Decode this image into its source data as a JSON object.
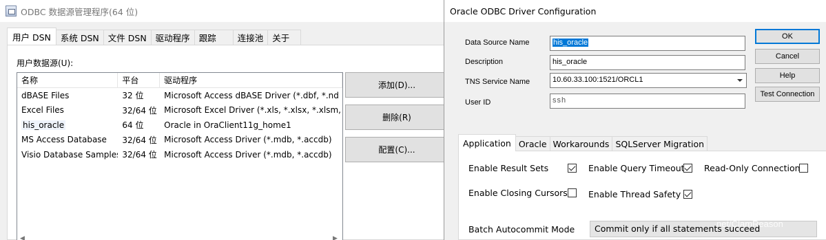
{
  "odbc": {
    "title": "ODBC 数据源管理程序(64 位)",
    "tabs": [
      "用户 DSN",
      "系统 DSN",
      "文件 DSN",
      "驱动程序",
      "跟踪",
      "连接池",
      "关于"
    ],
    "active_tab": "用户 DSN",
    "panel_label": "用户数据源(U):",
    "columns": [
      "名称",
      "平台",
      "驱动程序"
    ],
    "rows": [
      {
        "name": "dBASE Files",
        "platform": "32 位",
        "driver": "Microsoft Access dBASE Driver (*.dbf, *.nd"
      },
      {
        "name": "Excel Files",
        "platform": "32/64 位",
        "driver": "Microsoft Excel Driver (*.xls, *.xlsx, *.xlsm, *"
      },
      {
        "name": "his_oracle",
        "platform": "64 位",
        "driver": "Oracle in OraClient11g_home1"
      },
      {
        "name": "MS Access Database",
        "platform": "32/64 位",
        "driver": "Microsoft Access Driver (*.mdb, *.accdb)"
      },
      {
        "name": "Visio Database Samples",
        "platform": "32/64 位",
        "driver": "Microsoft Access Driver (*.mdb, *.accdb)"
      }
    ],
    "buttons": {
      "add": "添加(D)...",
      "remove": "删除(R)",
      "configure": "配置(C)..."
    }
  },
  "oracle": {
    "title": "Oracle ODBC Driver Configuration",
    "fields": {
      "data_source_name_label": "Data Source Name",
      "data_source_name": "his_oracle",
      "description_label": "Description",
      "description": "his_oracle",
      "tns_label": "TNS Service Name",
      "tns": "10.60.33.100:1521/ORCL1",
      "userid_label": "User ID",
      "userid": "ssh"
    },
    "buttons": {
      "ok": "OK",
      "cancel": "Cancel",
      "help": "Help",
      "test": "Test Connection"
    },
    "tabs": [
      "Application",
      "Oracle",
      "Workarounds",
      "SQLServer Migration"
    ],
    "active_tab": "Application",
    "options": {
      "enable_result_sets": {
        "label": "Enable Result Sets",
        "checked": true
      },
      "enable_query_timeout": {
        "label": "Enable Query Timeout",
        "checked": true
      },
      "read_only_connection": {
        "label": "Read-Only Connection",
        "checked": false
      },
      "enable_closing_cursors": {
        "label": "Enable Closing Cursors",
        "checked": false
      },
      "enable_thread_safety": {
        "label": "Enable Thread Safety",
        "checked": true
      }
    },
    "batch_label": "Batch Autocommit Mode",
    "batch_value": "Commit only if all statements succeed"
  },
  "watermark": "net/ClamReason"
}
